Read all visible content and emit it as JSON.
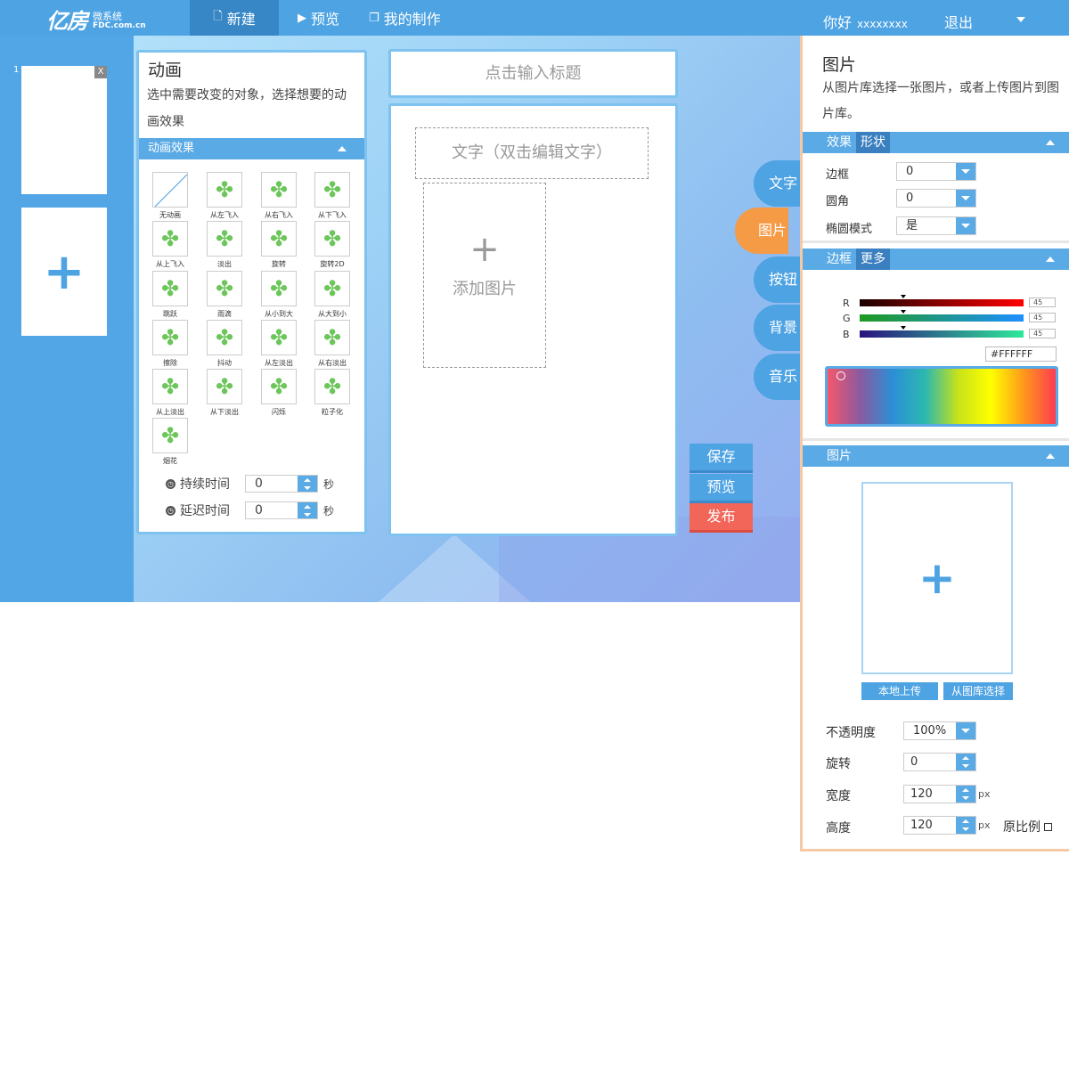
{
  "header": {
    "logo_main": "亿房",
    "logo_sub": "微系统",
    "logo_domain": "FDC.com.cn",
    "nav": [
      {
        "label": "新建",
        "icon": "file-icon"
      },
      {
        "label": "预览",
        "icon": "play-icon"
      },
      {
        "label": "我的制作",
        "icon": "copy-icon"
      }
    ],
    "greeting": "你好",
    "username": "xxxxxxxx",
    "logout": "退出"
  },
  "pages": {
    "thumb_number": "1",
    "close": "X",
    "add": "+"
  },
  "animation": {
    "title": "动画",
    "description": "选中需要改变的对象，选择想要的动画效果",
    "section": "动画效果",
    "effects": [
      "无动画",
      "从左飞入",
      "从右飞入",
      "从下飞入",
      "从上飞入",
      "淡出",
      "旋转",
      "旋转2D",
      "跳跃",
      "雨滴",
      "从小到大",
      "从大到小",
      "擦除",
      "抖动",
      "从左淡出",
      "从右淡出",
      "从上淡出",
      "从下淡出",
      "闪烁",
      "粒子化",
      "烟花"
    ],
    "duration_label": "持续时间",
    "duration_value": "0",
    "delay_label": "延迟时间",
    "delay_value": "0",
    "unit": "秒"
  },
  "editor": {
    "title_placeholder": "点击输入标题",
    "text_placeholder": "文字（双击编辑文字）",
    "add_image_plus": "+",
    "add_image": "添加图片"
  },
  "side_tabs": [
    "文字",
    "图片",
    "按钮",
    "背景",
    "音乐"
  ],
  "actions": {
    "save": "保存",
    "preview": "预览",
    "publish": "发布"
  },
  "props": {
    "title": "图片",
    "description": "从图片库选择一张图片，或者上传图片到图片库。",
    "effect_tab": "效果",
    "shape_tab": "形状",
    "border_label": "边框",
    "border_value": "0",
    "radius_label": "圆角",
    "radius_value": "0",
    "ellipse_label": "椭圆模式",
    "ellipse_value": "是",
    "border_tab": "边框",
    "more_tab": "更多",
    "r_label": "R",
    "g_label": "G",
    "b_label": "B",
    "r_value": "45",
    "g_value": "45",
    "b_value": "45",
    "hex": "#FFFFFF",
    "image_section": "图片",
    "image_plus": "+",
    "upload_local": "本地上传",
    "from_library": "从图库选择",
    "opacity_label": "不透明度",
    "opacity_value": "100%",
    "rotate_label": "旋转",
    "rotate_value": "0",
    "width_label": "宽度",
    "width_value": "120",
    "height_label": "高度",
    "height_value": "120",
    "px_unit": "px",
    "ratio_label": "原比例"
  },
  "colors": {
    "primary": "#4ea3e3",
    "active_tab": "#f59a45",
    "publish": "#f2665a"
  }
}
